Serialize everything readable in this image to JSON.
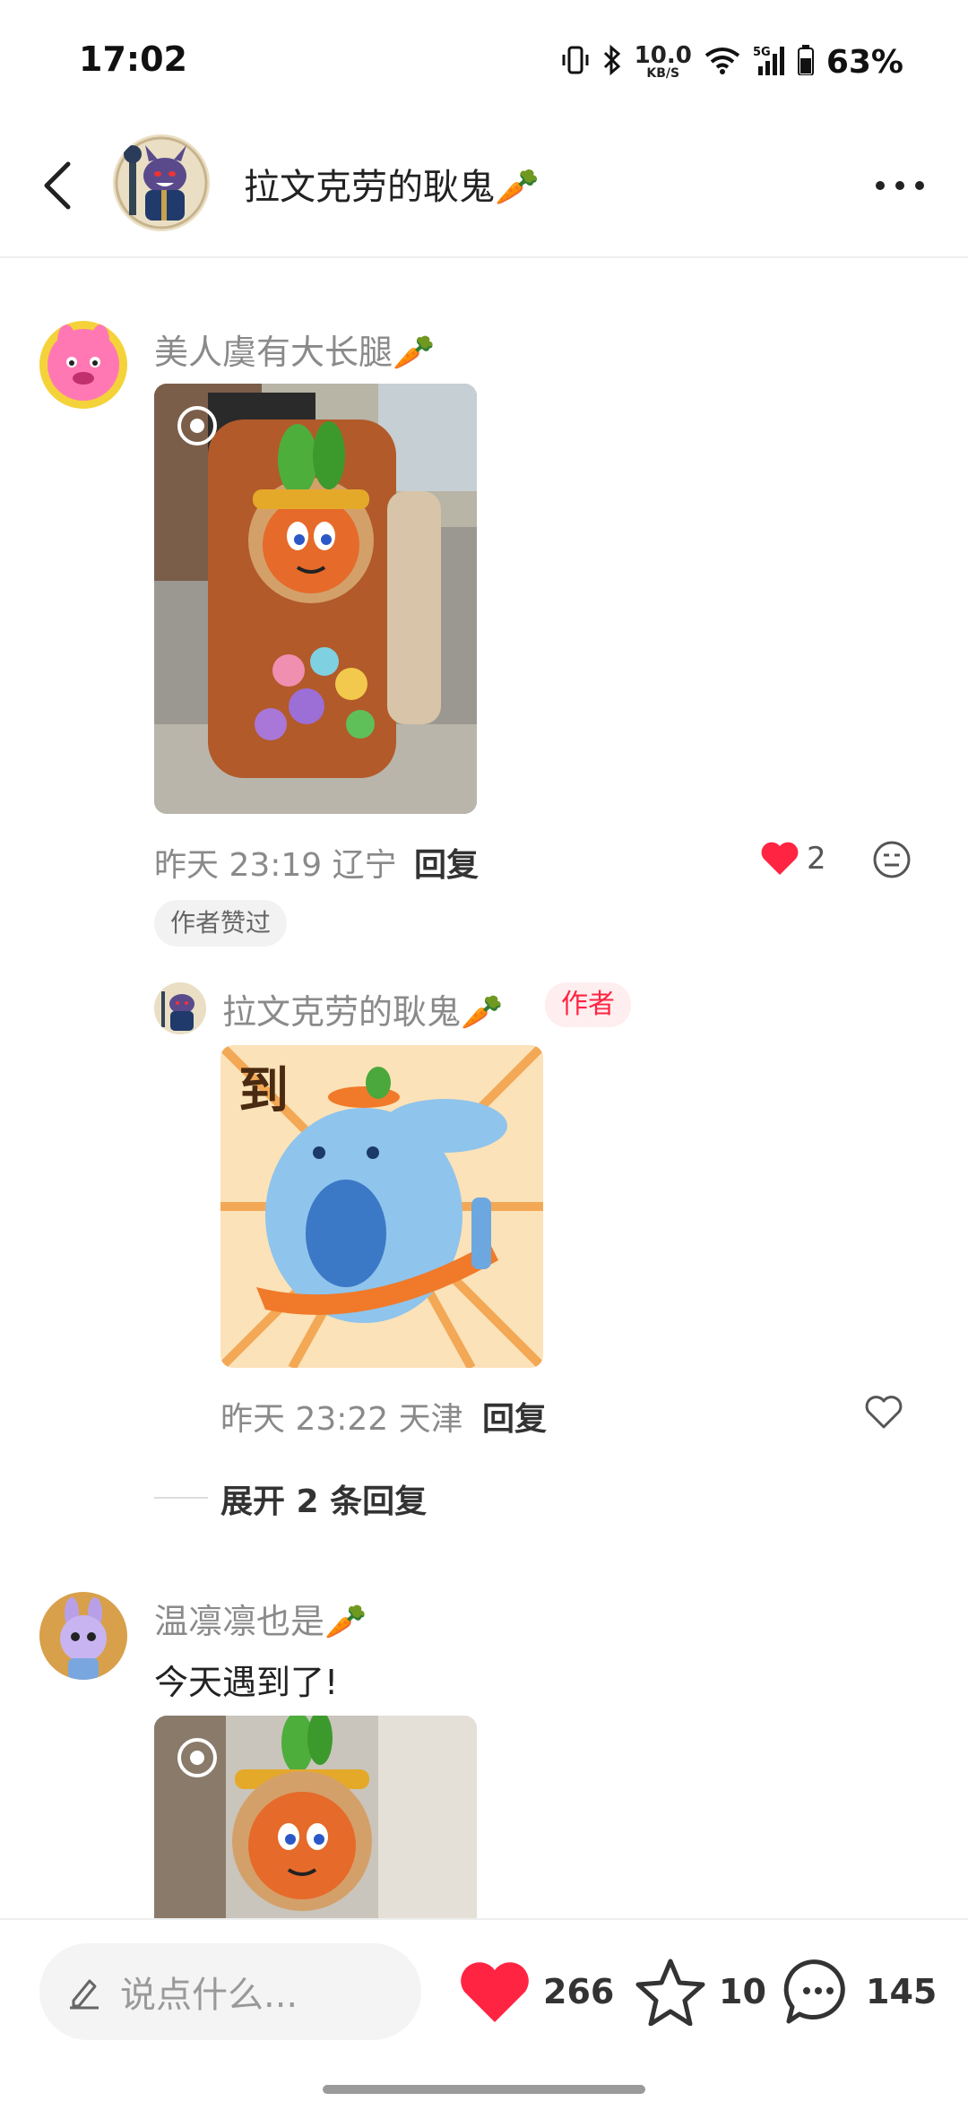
{
  "status_bar": {
    "time": "17:02",
    "net_speed": "10.0",
    "net_unit": "KB/S",
    "battery": "63%",
    "icons": [
      "vibrate-icon",
      "bluetooth-icon",
      "wifi-icon",
      "signal-5g-icon",
      "battery-icon"
    ]
  },
  "header": {
    "title": "拉文克劳的耿鬼🥕"
  },
  "comments": [
    {
      "name": "美人虞有大长腿🥕",
      "time_location": "昨天 23:19 辽宁",
      "reply_label": "回复",
      "like_count": "2",
      "liked": true,
      "tag": "作者赞过",
      "replies": [
        {
          "name": "拉文克劳的耿鬼🥕",
          "badge": "作者",
          "time_location": "昨天 23:22 天津",
          "reply_label": "回复",
          "sticker_text": "到"
        }
      ],
      "expand_label": "展开 2 条回复"
    },
    {
      "name": "温凛凛也是🥕",
      "text": "今天遇到了!"
    }
  ],
  "bottom_bar": {
    "input_placeholder": "说点什么...",
    "likes": "266",
    "favorites": "10",
    "comments": "145"
  },
  "colors": {
    "accent": "#ff2442",
    "muted_text": "#8a8a8a",
    "badge_bg": "#ffeef0"
  }
}
